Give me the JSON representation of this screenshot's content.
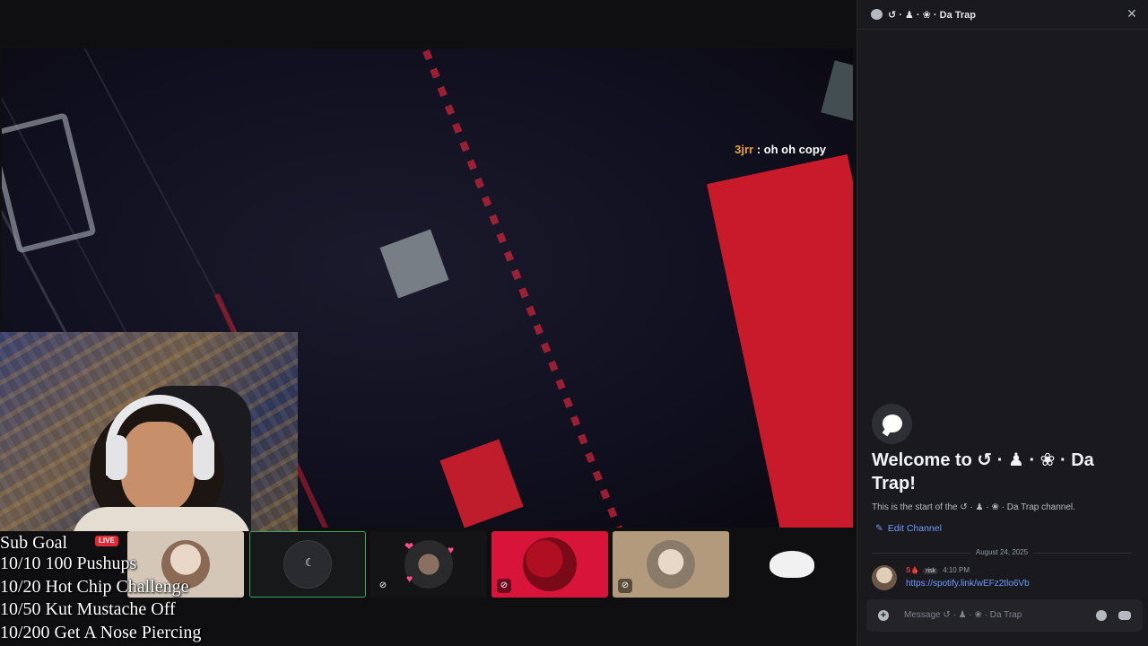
{
  "stream": {
    "chat_overlay": {
      "user": "3jrr",
      "separator": " : ",
      "message": "oh oh copy"
    },
    "live_badge": "LIVE",
    "sub_goal": {
      "title": "Sub Goal",
      "items": [
        "10/10 100 Pushups",
        "10/20 Hot Chip Challenge",
        "10/50 Kut Mustache Off",
        "10/200 Get A Nose Piercing"
      ]
    },
    "participants": [
      {
        "name": "participant-1",
        "muted": false
      },
      {
        "name": "participant-2",
        "muted": false,
        "speaking": true
      },
      {
        "name": "participant-3",
        "muted": true
      },
      {
        "name": "participant-4",
        "muted": true
      },
      {
        "name": "participant-5",
        "muted": true
      },
      {
        "name": "participant-6",
        "muted": false
      }
    ],
    "colors": {
      "speaking_outline": "#3ba55c",
      "accent_red": "#d9143a"
    }
  },
  "panel": {
    "channel_name": "↺ · ♟ · ❀ · Da Trap",
    "close_glyph": "✕",
    "welcome_title": "Welcome to ↺ · ♟ · ❀ · Da Trap!",
    "welcome_sub": "This is the start of the ↺ · ♟ · ❀ · Da Trap channel.",
    "edit_channel": "Edit Channel",
    "date_divider": "August 24, 2025",
    "message": {
      "author": "S🩸",
      "tag": "risk",
      "time": "4:10 PM",
      "text": "https://spotify.link/wEFz2tlo6Vb"
    },
    "composer_placeholder": "Message ↺ · ♟ · ❀ · Da Trap"
  }
}
